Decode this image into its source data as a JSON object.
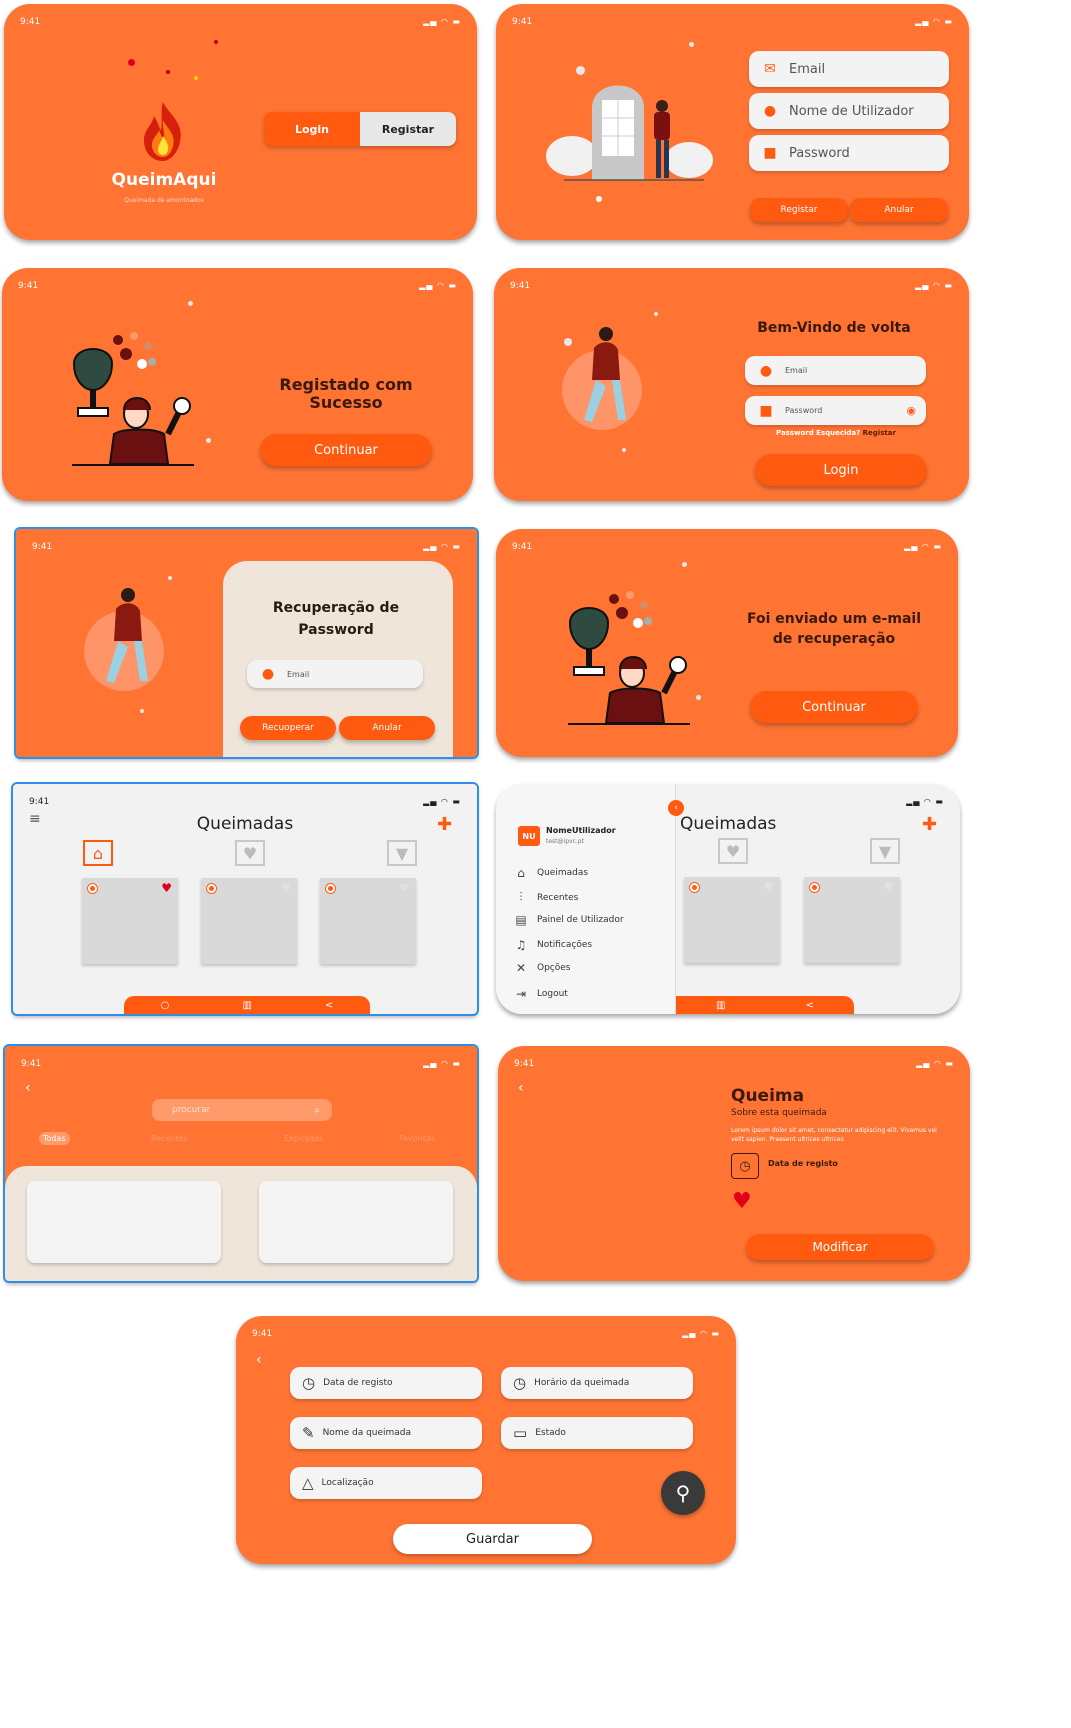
{
  "status": {
    "time": "9:41",
    "icons": "signal wifi battery"
  },
  "s1": {
    "logo_icon": "flame-icon",
    "brand": "QueimAqui",
    "tagline": "Queimada de amontoados",
    "login": "Login",
    "register": "Registar"
  },
  "s2": {
    "email": "Email",
    "username": "Nome de Utilizador",
    "password": "Password",
    "register": "Registar",
    "cancel": "Anular"
  },
  "s3": {
    "title": "Registado com Sucesso",
    "cont": "Continuar"
  },
  "s4": {
    "title": "Bem-Vindo de volta",
    "email": "Email",
    "password": "Password",
    "forgot": "Password Esquecida?",
    "register": "Registar",
    "login": "Login"
  },
  "s5": {
    "title": "Recuperação de Password",
    "email": "Email",
    "recover": "Recuoperar",
    "cancel": "Anular"
  },
  "s6": {
    "title": "Foi enviado um e-mail de recuperação",
    "cont": "Continuar"
  },
  "s7": {
    "title": "Queimadas"
  },
  "s8": {
    "avatar": "NU",
    "username": "NomeUtilizador",
    "email": "test@ipvc.pt",
    "title": "Queimadas",
    "menu": [
      "Queimadas",
      "Recentes",
      "Painel de Utilizador",
      "Notificações",
      "Opções",
      "Logout"
    ]
  },
  "s9": {
    "search": "procurar",
    "tabs": [
      "Todas",
      "Recentes",
      "Expiradas",
      "Favoritas"
    ]
  },
  "s10": {
    "title": "Queima",
    "subtitle": "Sobre esta queimada",
    "desc": "Lorem ipsum dolor sit amet, consectetur adipiscing elit. Vivamus vel velit sapien. Praesent ultrices ultrices",
    "date": "Data de registo",
    "modify": "Modificar"
  },
  "s11": {
    "f1": "Data de registo",
    "f2": "Horário da queimada",
    "f3": "Nome da queimada",
    "f4": "Estado",
    "f5": "Localização",
    "save": "Guardar"
  },
  "colors": {
    "orange": "#ff7433",
    "accent": "#ff5a10",
    "cream": "#efe5da"
  }
}
